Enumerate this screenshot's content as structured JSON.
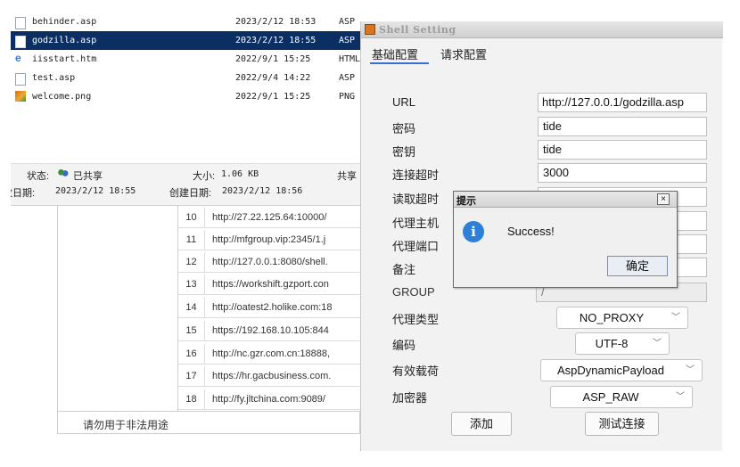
{
  "explorer": {
    "files": [
      {
        "name": "behinder.asp",
        "date": "2023/2/12 18:53",
        "type": "ASP",
        "icon": "file-icon",
        "selected": false
      },
      {
        "name": "godzilla.asp",
        "date": "2023/2/12 18:55",
        "type": "ASP",
        "icon": "file-icon",
        "selected": true
      },
      {
        "name": "iisstart.htm",
        "date": "2022/9/1 15:25",
        "type": "HTML",
        "icon": "html-file-icon",
        "selected": false
      },
      {
        "name": "test.asp",
        "date": "2022/9/4 14:22",
        "type": "ASP",
        "icon": "file-icon",
        "selected": false
      },
      {
        "name": "welcome.png",
        "date": "2022/9/1 15:25",
        "type": "PNG",
        "icon": "image-file-icon",
        "selected": false
      }
    ],
    "status": {
      "state_label": "状态:",
      "state_value": "已共享",
      "size_label": "大小:",
      "size_value": "1.06 KB",
      "shared_label": "共享",
      "modified_label": "改日期:",
      "modified_value": "2023/2/12 18:55",
      "created_label": "创建日期:",
      "created_value": "2023/2/12 18:56"
    }
  },
  "url_table": {
    "rows": [
      {
        "num": "10",
        "url": "http://27.22.125.64:10000/"
      },
      {
        "num": "11",
        "url": "http://mfgroup.vip:2345/1.j"
      },
      {
        "num": "12",
        "url": "http://127.0.0.1:8080/shell."
      },
      {
        "num": "13",
        "url": "https://workshift.gzport.con"
      },
      {
        "num": "14",
        "url": "http://oatest2.holike.com:18"
      },
      {
        "num": "15",
        "url": "https://192.168.10.105:844"
      },
      {
        "num": "16",
        "url": "http://nc.gzr.com.cn:18888,"
      },
      {
        "num": "17",
        "url": "https://hr.gacbusiness.com."
      },
      {
        "num": "18",
        "url": "http://fy.jltchina.com:9089/"
      }
    ],
    "footer_text": "请勿用于非法用途"
  },
  "shell_setting": {
    "title": "Shell Setting",
    "tabs": [
      "基础配置",
      "请求配置"
    ],
    "fields": {
      "url_label": "URL",
      "url_value": "http://127.0.0.1/godzilla.asp",
      "password_label": "密码",
      "password_value": "tide",
      "key_label": "密钥",
      "key_value": "tide",
      "conn_timeout_label": "连接超时",
      "conn_timeout_value": "3000",
      "read_timeout_label": "读取超时",
      "proxy_host_label": "代理主机",
      "proxy_port_label": "代理端口",
      "remark_label": "备注",
      "group_label": "GROUP",
      "group_value": "/",
      "proxy_type_label": "代理类型",
      "proxy_type_value": "NO_PROXY",
      "encoding_label": "编码",
      "encoding_value": "UTF-8",
      "payload_label": "有效载荷",
      "payload_value": "AspDynamicPayload",
      "encryptor_label": "加密器",
      "encryptor_value": "ASP_RAW"
    },
    "buttons": {
      "add": "添加",
      "test": "测试连接"
    }
  },
  "dialog": {
    "title": "提示",
    "message": "Success!",
    "ok_label": "确定",
    "close_glyph": "×"
  }
}
